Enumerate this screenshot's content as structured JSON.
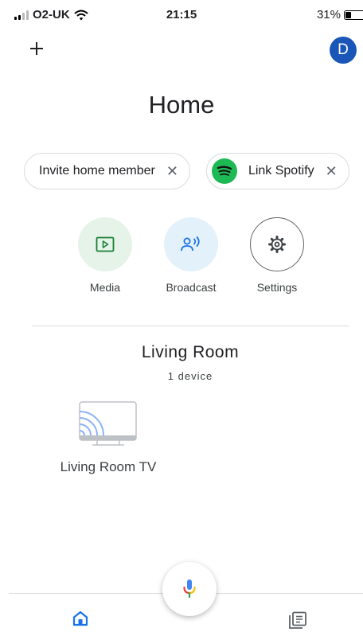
{
  "status_bar": {
    "carrier": "O2-UK",
    "time": "21:15",
    "battery": "31%",
    "battery_level": 0.31
  },
  "header": {
    "avatar_initial": "D",
    "title": "Home"
  },
  "chips": [
    {
      "label": "Invite home member",
      "icon": "close-icon"
    },
    {
      "label": "Link Spotify",
      "icon": "spotify-icon"
    }
  ],
  "actions": [
    {
      "label": "Media",
      "icon": "media-play-icon"
    },
    {
      "label": "Broadcast",
      "icon": "broadcast-icon"
    },
    {
      "label": "Settings",
      "icon": "gear-icon"
    }
  ],
  "room": {
    "title": "Living Room",
    "device_count": "1 device",
    "devices": [
      {
        "label": "Living Room TV",
        "icon": "cast-tv-icon"
      }
    ]
  },
  "nav": {
    "home_icon": "home-icon",
    "feed_icon": "feed-icon",
    "mic_icon": "mic-icon"
  },
  "colors": {
    "avatar": "#1a56b8",
    "spotify": "#1db954",
    "media_bg": "#e5f3e9",
    "broadcast_bg": "#e3f1fb",
    "accent_blue": "#1a73e8"
  }
}
